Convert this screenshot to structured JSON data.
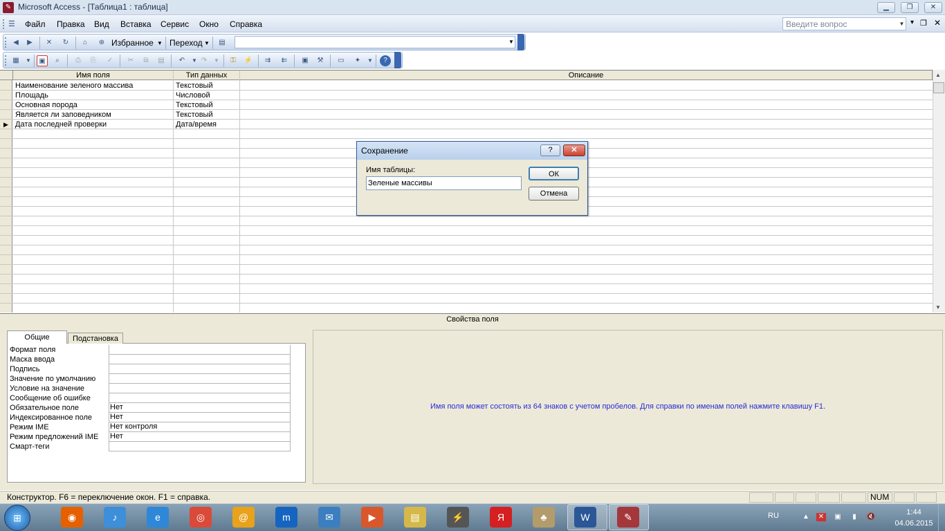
{
  "window": {
    "title": "Microsoft Access - [Таблица1 : таблица]",
    "minimize_icon": "minimize-icon",
    "restore_icon": "restore-icon",
    "close_icon": "close-icon"
  },
  "menubar": {
    "items": [
      "Файл",
      "Правка",
      "Вид",
      "Вставка",
      "Сервис",
      "Окно",
      "Справка"
    ],
    "help_placeholder": "Введите вопрос"
  },
  "web_toolbar": {
    "favorites_label": "Избранное",
    "goto_label": "Переход",
    "address_value": ""
  },
  "grid": {
    "headers": [
      "Имя поля",
      "Тип данных",
      "Описание"
    ],
    "rows": [
      {
        "name": "Наименование зеленого массива",
        "type": "Текстовый",
        "desc": ""
      },
      {
        "name": "Площадь",
        "type": "Числовой",
        "desc": ""
      },
      {
        "name": "Основная порода",
        "type": "Текстовый",
        "desc": ""
      },
      {
        "name": "Является ли заповедником",
        "type": "Текстовый",
        "desc": ""
      },
      {
        "name": "Дата последней проверки",
        "type": "Дата/время",
        "desc": ""
      }
    ],
    "current_row_index": 4
  },
  "properties": {
    "section_title": "Свойства поля",
    "tabs": [
      "Общие",
      "Подстановка"
    ],
    "active_tab": "Общие",
    "rows": [
      {
        "label": "Формат поля",
        "value": ""
      },
      {
        "label": "Маска ввода",
        "value": ""
      },
      {
        "label": "Подпись",
        "value": ""
      },
      {
        "label": "Значение по умолчанию",
        "value": ""
      },
      {
        "label": "Условие на значение",
        "value": ""
      },
      {
        "label": "Сообщение об ошибке",
        "value": ""
      },
      {
        "label": "Обязательное поле",
        "value": "Нет"
      },
      {
        "label": "Индексированное поле",
        "value": "Нет"
      },
      {
        "label": "Режим IME",
        "value": "Нет контроля"
      },
      {
        "label": "Режим предложений IME",
        "value": "Нет"
      },
      {
        "label": "Смарт-теги",
        "value": ""
      }
    ],
    "hint": "Имя поля может состоять из 64 знаков с учетом пробелов.  Для справки по именам полей нажмите клавишу F1."
  },
  "statusbar": {
    "text": "Конструктор.  F6 = переключение окон.  F1 = справка.",
    "num": "NUM"
  },
  "dialog": {
    "title": "Сохранение",
    "help_glyph": "?",
    "close_glyph": "✕",
    "label": "Имя таблицы:",
    "input_value": "Зеленые массивы",
    "ok_label": "ОК",
    "cancel_label": "Отмена"
  },
  "taskbar": {
    "icons": [
      "firefox-icon",
      "volume-icon",
      "ie-icon",
      "chrome-icon",
      "mail-at-icon",
      "maxthon-icon",
      "mail-icon",
      "media-icon",
      "explorer-icon",
      "winamp-icon",
      "yandex-icon",
      "mahjong-icon",
      "word-icon",
      "access-icon"
    ],
    "language": "RU",
    "time": "1:44",
    "date": "04.06.2015"
  },
  "colors": {
    "accent": "#3a67b0",
    "hint_text": "#2a2ad6",
    "dialog_close": "#c9432d"
  }
}
